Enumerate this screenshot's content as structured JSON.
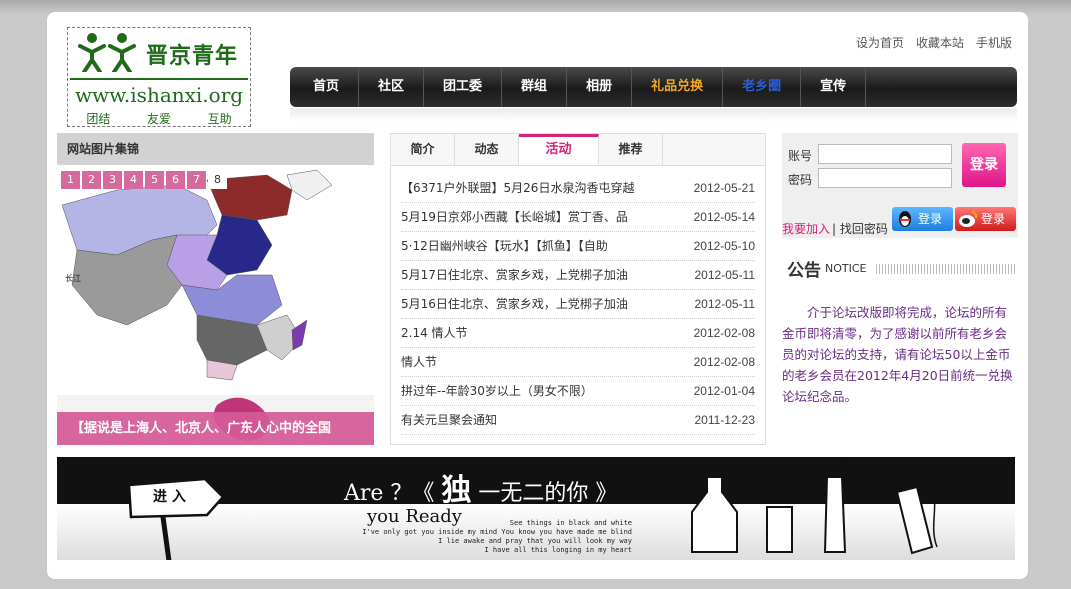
{
  "header": {
    "logo": {
      "name": "晋京青年",
      "url": "www.ishanxi.org",
      "mottos": [
        "团结",
        "友爱",
        "互助"
      ]
    },
    "top_links": [
      "设为首页",
      "收藏本站",
      "手机版"
    ],
    "nav": [
      {
        "label": "首页",
        "color": "#ffffff"
      },
      {
        "label": "社区",
        "color": "#ffffff"
      },
      {
        "label": "团工委",
        "color": "#ffffff"
      },
      {
        "label": "群组",
        "color": "#ffffff"
      },
      {
        "label": "相册",
        "color": "#ffffff"
      },
      {
        "label": "礼品兑换",
        "color": "#f5a623"
      },
      {
        "label": "老乡圈",
        "color": "#2b5fd9"
      },
      {
        "label": "宣传",
        "color": "#ffffff"
      }
    ]
  },
  "gallery": {
    "title": "网站图片集锦",
    "pages": [
      "1",
      "2",
      "3",
      "4",
      "5",
      "6",
      "7",
      "8"
    ],
    "caption": "【据说是上海人、北京人、广东人心中的全国"
  },
  "news": {
    "tabs": [
      "简介",
      "动态",
      "活动",
      "推荐"
    ],
    "active_tab": "活动",
    "items": [
      {
        "title": "【6371户外联盟】5月26日水泉沟香屯穿越",
        "date": "2012-05-21"
      },
      {
        "title": "5月19日京郊小西藏【长峪城】赏丁香、品",
        "date": "2012-05-14"
      },
      {
        "title": "5·12日幽州峡谷【玩水】【抓鱼】【自助",
        "date": "2012-05-10"
      },
      {
        "title": "5月17日住北京、赏家乡戏，上党梆子加油",
        "date": "2012-05-11"
      },
      {
        "title": "5月16日住北京、赏家乡戏，上党梆子加油",
        "date": "2012-05-11"
      },
      {
        "title": "2.14 情人节",
        "date": "2012-02-08"
      },
      {
        "title": "情人节",
        "date": "2012-02-08"
      },
      {
        "title": "拼过年--年龄30岁以上（男女不限）",
        "date": "2012-01-04"
      },
      {
        "title": "有关元旦聚会通知",
        "date": "2011-12-23"
      }
    ]
  },
  "login": {
    "account_label": "账号",
    "password_label": "密码",
    "submit": "登录",
    "join": "我要加入",
    "forgot": "| 找回密码",
    "qq_login": "登录",
    "weibo_login": "登录"
  },
  "notice": {
    "title": "公告",
    "title_en": "NOTICE",
    "body": "介于论坛改版即将完成，论坛的所有金币即将清零，为了感谢以前所有老乡会员的对论坛的支持，请有论坛50以上金币的老乡会员在2012年4月20日前统一兑换论坛纪念品。"
  },
  "banner": {
    "enter": "进 入",
    "title_pre": "Are ？《",
    "title_big": "独",
    "title_post": "一无二的你 》",
    "subtitle": "you Ready",
    "lines": [
      "See things in black and white",
      "I've only got you inside my mind You know you have made me blind",
      "I lie awake and pray that you will look my way",
      "I have all this longing in my heart"
    ]
  }
}
